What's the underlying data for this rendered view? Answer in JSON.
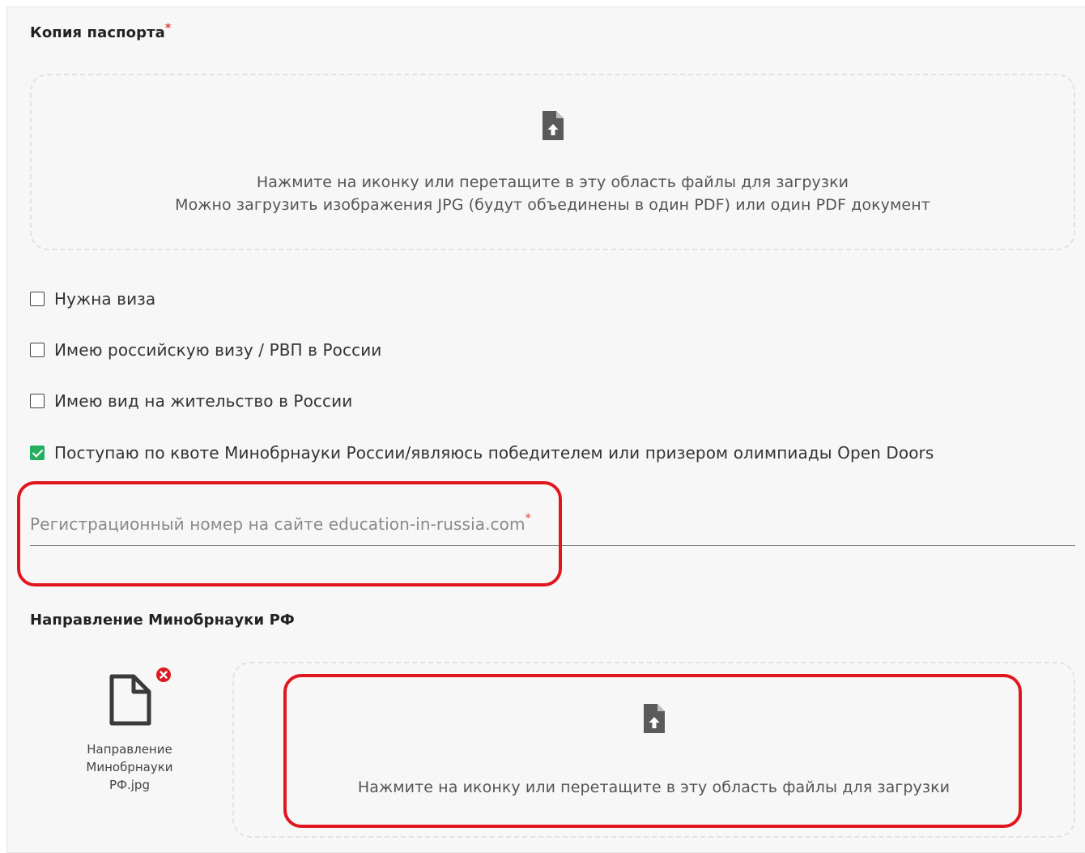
{
  "passport": {
    "title": "Копия паспорта",
    "required_mark": "*",
    "dropzone": {
      "icon": "file-upload-icon",
      "line1": "Нажмите на иконку или перетащите в эту область файлы для загрузки",
      "line2": "Можно загрузить изображения JPG (будут объединены в один PDF) или один PDF документ"
    }
  },
  "checkboxes": [
    {
      "label": "Нужна виза",
      "checked": false
    },
    {
      "label": "Имею российскую визу / РВП в России",
      "checked": false
    },
    {
      "label": "Имею вид на жительство в России",
      "checked": false
    },
    {
      "label": "Поступаю по квоте Минобрнауки России/являюсь победителем или призером олимпиады Open Doors",
      "checked": true
    }
  ],
  "registration": {
    "label": "Регистрационный номер на сайте education-in-russia.com",
    "required_mark": "*",
    "value": ""
  },
  "direction": {
    "title": "Направление Минобрнауки РФ",
    "file": {
      "icon": "document-icon",
      "name": "Направление Минобрнауки РФ.jpg",
      "remove_icon": "remove-icon"
    },
    "dropzone": {
      "icon": "file-upload-icon",
      "line1": "Нажмите на иконку или перетащите в эту область файлы для загрузки"
    }
  },
  "colors": {
    "required": "#e53935",
    "checked": "#27ae60",
    "highlight": "#e0171f",
    "panel_bg": "#f7f7f7"
  }
}
